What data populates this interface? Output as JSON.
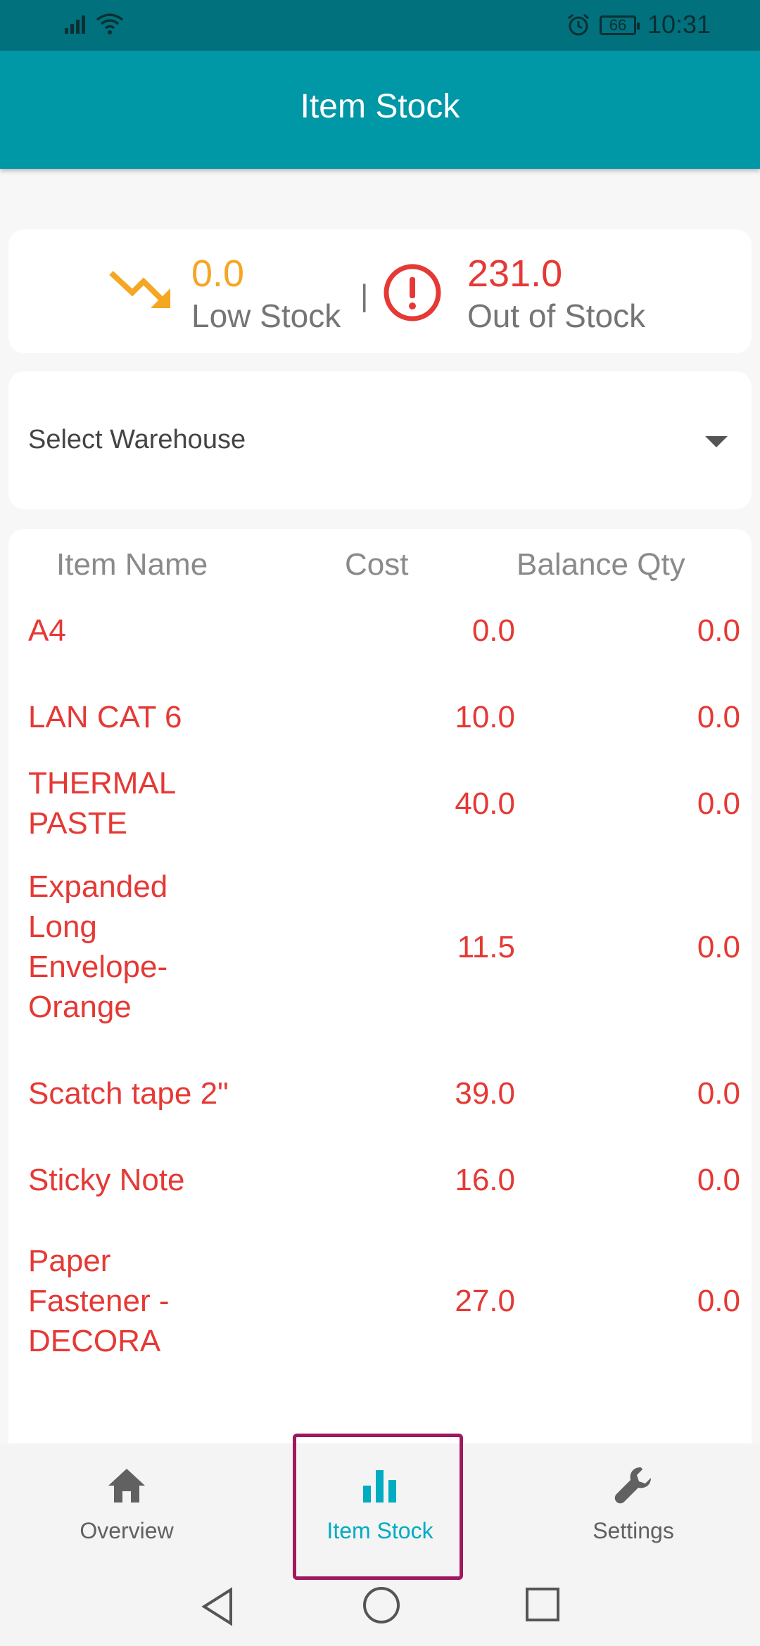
{
  "status_bar": {
    "time": "10:31",
    "battery": "66",
    "icons": [
      "signal-icon",
      "wifi-icon",
      "alarm-icon",
      "battery-icon"
    ]
  },
  "app_bar": {
    "title": "Item Stock"
  },
  "summary": {
    "low_stock_value": "0.0",
    "low_stock_label": "Low Stock",
    "separator": "|",
    "out_of_stock_value": "231.0",
    "out_of_stock_label": "Out of Stock"
  },
  "warehouse_select": {
    "label": "Select Warehouse"
  },
  "table": {
    "headers": {
      "name": "Item Name",
      "cost": "Cost",
      "qty": "Balance Qty"
    },
    "rows": [
      {
        "name": "A4",
        "cost": "0.0",
        "qty": "0.0"
      },
      {
        "name": "LAN CAT 6",
        "cost": "10.0",
        "qty": "0.0"
      },
      {
        "name": "THERMAL PASTE",
        "cost": "40.0",
        "qty": "0.0"
      },
      {
        "name": "Expanded Long Envelope-Orange",
        "cost": "11.5",
        "qty": "0.0"
      },
      {
        "name": "Scatch tape 2\"",
        "cost": "39.0",
        "qty": "0.0"
      },
      {
        "name": "Sticky Note",
        "cost": "16.0",
        "qty": "0.0"
      },
      {
        "name": "Paper Fastener - DECORA",
        "cost": "27.0",
        "qty": "0.0"
      }
    ]
  },
  "bottom_nav": {
    "items": [
      {
        "label": "Overview",
        "icon": "home-icon"
      },
      {
        "label": "Item Stock",
        "icon": "bar-chart-icon",
        "active": true
      },
      {
        "label": "Settings",
        "icon": "wrench-icon"
      }
    ]
  },
  "colors": {
    "app_bar": "#0097a7",
    "status_bar": "#00717d",
    "accent": "#00acc1",
    "low_stock": "#f5a623",
    "out_of_stock": "#e53935",
    "highlight_border": "#a0185f"
  }
}
